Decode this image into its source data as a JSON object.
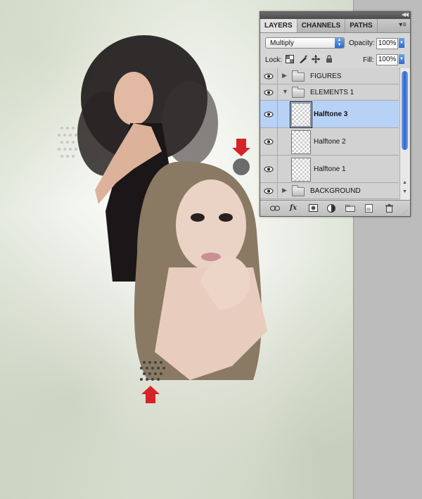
{
  "panel": {
    "tabs": [
      {
        "label": "LAYERS",
        "active": true
      },
      {
        "label": "CHANNELS",
        "active": false
      },
      {
        "label": "PATHS",
        "active": false
      }
    ],
    "blend_mode": "Multiply",
    "opacity_label": "Opacity:",
    "opacity_value": "100%",
    "lock_label": "Lock:",
    "fill_label": "Fill:",
    "fill_value": "100%",
    "layers": [
      {
        "name": "FIGURES",
        "type": "group",
        "expanded": false,
        "visible": true,
        "selected": false
      },
      {
        "name": "ELEMENTS 1",
        "type": "group",
        "expanded": true,
        "visible": true,
        "selected": false
      },
      {
        "name": "Halftone 3",
        "type": "layer",
        "visible": true,
        "selected": true
      },
      {
        "name": "Halftone 2",
        "type": "layer",
        "visible": true,
        "selected": false
      },
      {
        "name": "Halftone 1",
        "type": "layer",
        "visible": true,
        "selected": false
      },
      {
        "name": "BACKGROUND",
        "type": "group",
        "expanded": false,
        "visible": true,
        "selected": false
      }
    ],
    "footer_icons": [
      "link-icon",
      "fx-icon",
      "mask-icon",
      "adjustment-icon",
      "new-group-icon",
      "new-layer-icon",
      "trash-icon"
    ]
  },
  "colors": {
    "selection": "#b8d2f6",
    "accent_blue": "#2c6bd2",
    "arrow_red": "#d6232a"
  }
}
